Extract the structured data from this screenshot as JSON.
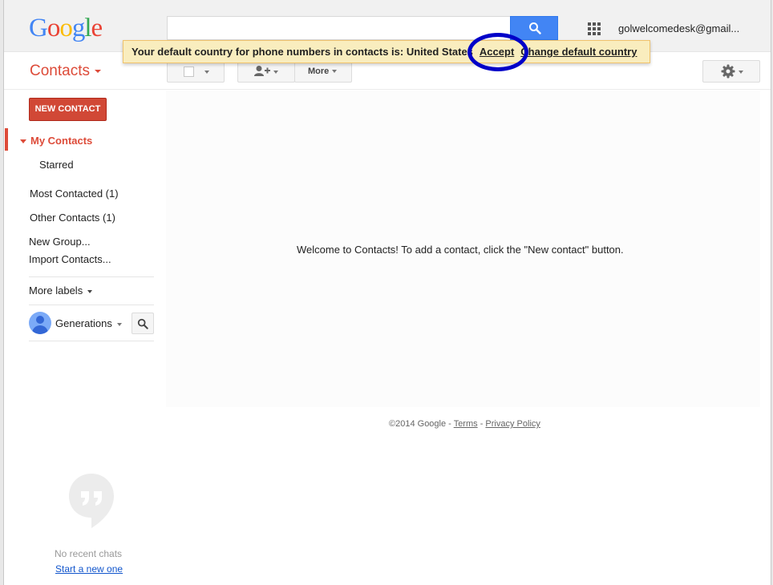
{
  "header": {
    "logo_letters": [
      {
        "ch": "G",
        "color": "#4285f4"
      },
      {
        "ch": "o",
        "color": "#ea4335"
      },
      {
        "ch": "o",
        "color": "#fbbc05"
      },
      {
        "ch": "g",
        "color": "#4285f4"
      },
      {
        "ch": "l",
        "color": "#34a853"
      },
      {
        "ch": "e",
        "color": "#ea4335"
      }
    ],
    "search_placeholder": "",
    "account_email": "golwelcomedesk@gmail..."
  },
  "notice": {
    "message": "Your default country for phone numbers in contacts is: United States",
    "accept_label": "Accept",
    "change_label": "Change default country",
    "highlight_color": "#0000c8"
  },
  "app": {
    "title": "Contacts",
    "accent_color": "#dd4b39"
  },
  "toolbar": {
    "more_label": "More"
  },
  "sidebar": {
    "new_contact_label": "NEW CONTACT",
    "my_contacts": "My Contacts",
    "starred": "Starred",
    "most_contacted": "Most Contacted (1)",
    "other_contacts": "Other Contacts (1)",
    "new_group": "New Group...",
    "import_contacts": "Import Contacts...",
    "more_labels": "More labels",
    "chat_user": "Generations"
  },
  "main": {
    "welcome_text": "Welcome to Contacts! To add a contact, click the \"New contact\" button."
  },
  "footer": {
    "copyright": "©2014 Google - ",
    "terms": "Terms",
    "separator": " - ",
    "privacy": "Privacy Policy"
  },
  "chat": {
    "no_recent": "No recent chats",
    "start_new": "Start a new one"
  }
}
